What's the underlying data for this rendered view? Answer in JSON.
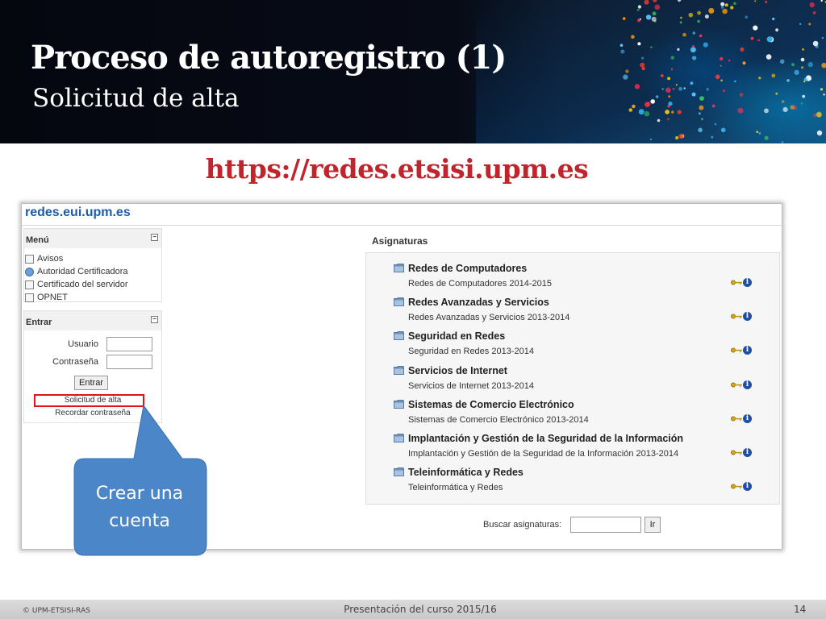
{
  "slide": {
    "title": "Proceso de autoregistro (1)",
    "subtitle": "Solicitud de alta",
    "url": "https://redes.etsisi.upm.es"
  },
  "site": {
    "name": "redes.eui.upm.es"
  },
  "sidebar": {
    "menu": {
      "header": "Menú",
      "items": [
        {
          "label": "Avisos",
          "icon": "notice-icon"
        },
        {
          "label": "Autoridad Certificadora",
          "icon": "globe-icon"
        },
        {
          "label": "Certificado del servidor",
          "icon": "certificate-icon"
        },
        {
          "label": "OPNET",
          "icon": "document-icon"
        }
      ]
    },
    "login": {
      "header": "Entrar",
      "user_label": "Usuario",
      "password_label": "Contraseña",
      "submit_label": "Entrar",
      "signup_link": "Solicitud de alta",
      "recover_link": "Recordar contraseña"
    }
  },
  "courses": {
    "title": "Asignaturas",
    "items": [
      {
        "name": "Redes de Computadores",
        "sub": "Redes de Computadores 2014-2015"
      },
      {
        "name": "Redes Avanzadas y Servicios",
        "sub": "Redes Avanzadas y Servicios 2013-2014"
      },
      {
        "name": "Seguridad en Redes",
        "sub": "Seguridad en Redes 2013-2014"
      },
      {
        "name": "Servicios de Internet",
        "sub": "Servicios de Internet 2013-2014"
      },
      {
        "name": "Sistemas de Comercio Electrónico",
        "sub": "Sistemas de Comercio Electrónico 2013-2014"
      },
      {
        "name": "Implantación y Gestión de la Seguridad de la Información",
        "sub": "Implantación y Gestión de la Seguridad de la Información 2013-2014"
      },
      {
        "name": "Teleinformática y Redes",
        "sub": "Teleinformática y Redes"
      }
    ],
    "info_glyph": "i"
  },
  "search": {
    "label": "Buscar asignaturas:",
    "button_label": "Ir"
  },
  "callout": {
    "text_line1": "Crear una",
    "text_line2": "cuenta"
  },
  "footer": {
    "left": "© UPM-ETSISI-RAS",
    "center": "Presentación del curso 2015/16",
    "page_number": "14"
  },
  "colors": {
    "url_heading": "#c0242d",
    "site_link": "#1f5ca8",
    "highlight": "#e0131b",
    "callout": "#4a86c8"
  }
}
